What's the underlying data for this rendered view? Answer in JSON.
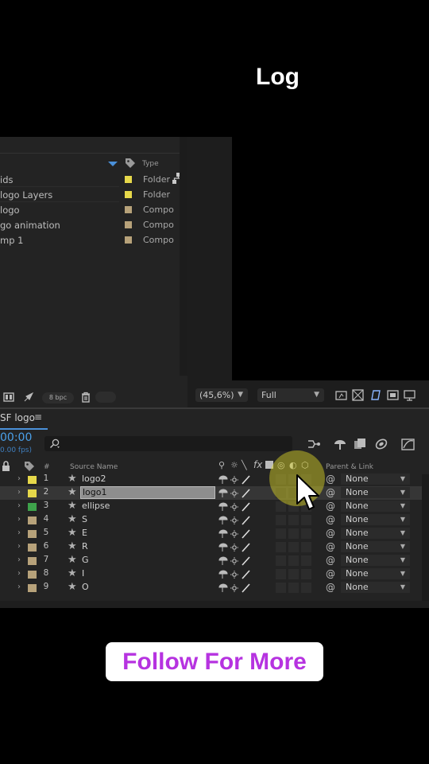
{
  "overlay": {
    "top_caption": "Log",
    "follow_button": "Follow For More"
  },
  "colors": {
    "folder_label": "#e6d84a",
    "compo_label": "#b7a27a",
    "green_label": "#3ea34b",
    "selection_blue": "#4a90d9",
    "follow_text": "#b633e0",
    "cursor_highlight": "#e2dc28"
  },
  "project_panel": {
    "type_header": "Type",
    "items": [
      {
        "name": "ids",
        "type": "Folder",
        "label_color": "#e6d84a"
      },
      {
        "name": "logo Layers",
        "type": "Folder",
        "label_color": "#e6d84a"
      },
      {
        "name": "logo",
        "type": "Compo",
        "label_color": "#b7a27a"
      },
      {
        "name": "go animation",
        "type": "Compo",
        "label_color": "#b7a27a"
      },
      {
        "name": "mp 1",
        "type": "Compo",
        "label_color": "#b7a27a"
      }
    ],
    "footer": {
      "bpc": "8 bpc",
      "icons": [
        "interpret-footage-icon",
        "render-queue-icon",
        "trash-icon"
      ]
    }
  },
  "viewer": {
    "zoom": "(45,6%)",
    "resolution": "Full"
  },
  "timeline": {
    "comp_tab": "SF logo",
    "tab_menu": "≡",
    "timecode": "00:00",
    "fps": "0.00 fps)",
    "columns": {
      "num": "#",
      "source_name": "Source Name",
      "parent_link": "Parent & Link"
    },
    "layers": [
      {
        "num": "1",
        "name": "logo2",
        "label_color": "#e6d84a",
        "parent": "None",
        "selected": false
      },
      {
        "num": "2",
        "name": "logo1",
        "label_color": "#e6d84a",
        "parent": "None",
        "selected": true
      },
      {
        "num": "3",
        "name": "ellipse",
        "label_color": "#3ea34b",
        "parent": "None",
        "selected": false
      },
      {
        "num": "4",
        "name": "S",
        "label_color": "#b7a27a",
        "parent": "None",
        "selected": false
      },
      {
        "num": "5",
        "name": "E",
        "label_color": "#b7a27a",
        "parent": "None",
        "selected": false
      },
      {
        "num": "6",
        "name": "R",
        "label_color": "#b7a27a",
        "parent": "None",
        "selected": false
      },
      {
        "num": "7",
        "name": "G",
        "label_color": "#b7a27a",
        "parent": "None",
        "selected": false
      },
      {
        "num": "8",
        "name": "I",
        "label_color": "#b7a27a",
        "parent": "None",
        "selected": false
      },
      {
        "num": "9",
        "name": "O",
        "label_color": "#b7a27a",
        "parent": "None",
        "selected": false
      }
    ]
  }
}
